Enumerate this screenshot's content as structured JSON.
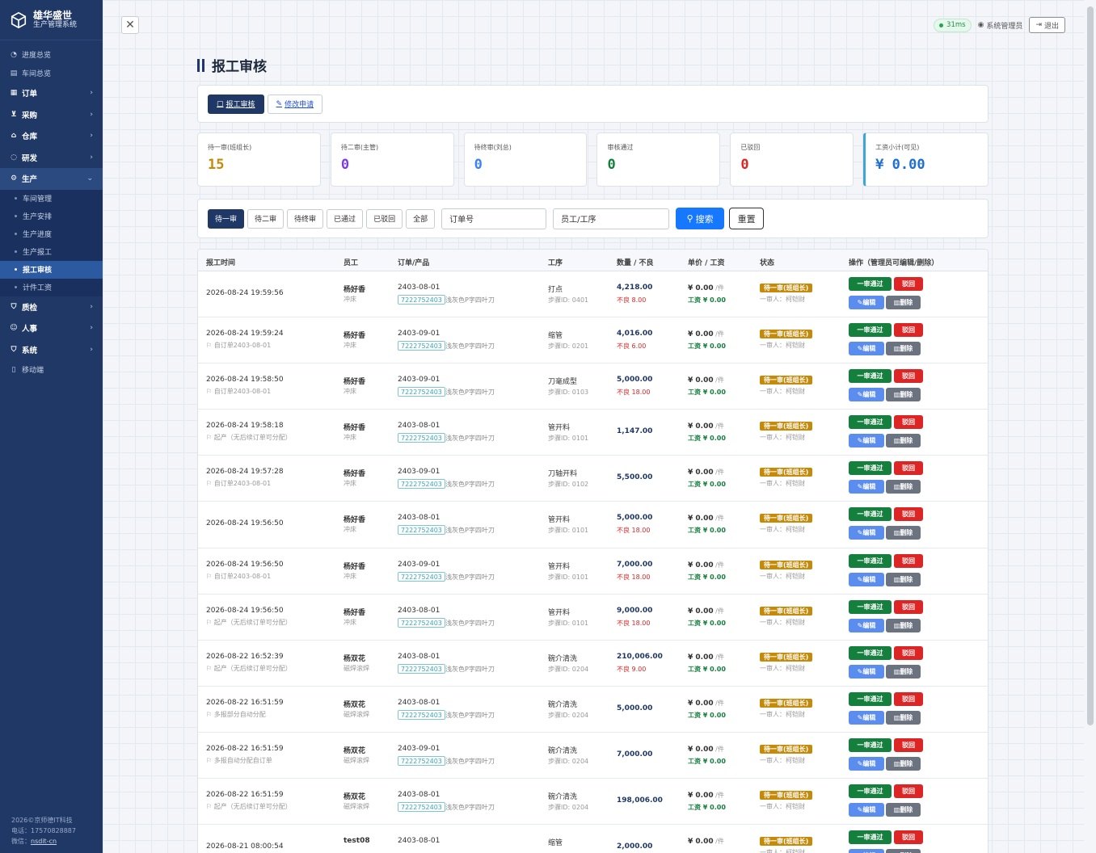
{
  "brand": {
    "title": "雄华盛世",
    "subtitle": "生产管理系统"
  },
  "sidebar": {
    "top": [
      {
        "label": "进度总览"
      },
      {
        "label": "车间总览"
      }
    ],
    "groups": [
      {
        "label": "订单"
      },
      {
        "label": "采购"
      },
      {
        "label": "仓库"
      },
      {
        "label": "研发"
      }
    ],
    "production": {
      "label": "生产",
      "items": [
        {
          "label": "车间管理"
        },
        {
          "label": "生产安排"
        },
        {
          "label": "生产进度"
        },
        {
          "label": "生产报工"
        },
        {
          "label": "报工审核"
        },
        {
          "label": "计件工资"
        }
      ]
    },
    "groups2": [
      {
        "label": "质检"
      },
      {
        "label": "人事"
      },
      {
        "label": "系统"
      }
    ],
    "mobile": "移动端",
    "footer": {
      "copy": "2026©京师德IT科技",
      "phone": "电话：17570828887",
      "wechat_label": "微信：",
      "wechat": "nsdit-cn"
    }
  },
  "topbar": {
    "ping": "31ms",
    "user": "系统管理员",
    "logout": "退出"
  },
  "page": {
    "title": "报工审核"
  },
  "tabs": [
    {
      "label": "报工审核"
    },
    {
      "label": "修改申请"
    }
  ],
  "stats": [
    {
      "label": "待一审(班组长)",
      "value": "15",
      "color": "#c58a09"
    },
    {
      "label": "待二审(主管)",
      "value": "0",
      "color": "#7c3aed"
    },
    {
      "label": "待终审(刘总)",
      "value": "0",
      "color": "#3b82f6"
    },
    {
      "label": "审核通过",
      "value": "0",
      "color": "#15803d"
    },
    {
      "label": "已驳回",
      "value": "0",
      "color": "#dc2626"
    },
    {
      "label": "工资小计(可见)",
      "value": "¥ 0.00",
      "color": "#1d6fd8"
    }
  ],
  "filters": {
    "buttons": [
      "待一审",
      "待二审",
      "待终审",
      "已通过",
      "已驳回",
      "全部"
    ],
    "order_placeholder": "订单号",
    "worker_placeholder": "员工/工序",
    "search": "搜索",
    "reset": "重置"
  },
  "table": {
    "headers": [
      "报工时间",
      "员工",
      "订单/产品",
      "工序",
      "数量 / 不良",
      "单价 / 工资",
      "状态",
      "操作（管理员可编辑/删除）"
    ],
    "labels": {
      "pass": "一审通过",
      "reject": "驳回",
      "edit": "编辑",
      "delete": "删除",
      "unit": "/件",
      "wage_prefix": "工资 ",
      "bad_prefix": "不良 ",
      "step_prefix": "步骤ID: ",
      "reviewer": "一审人：柯铠财"
    },
    "rows": [
      {
        "time": "2026-08-24 19:59:56",
        "src": "",
        "name": "杨好香",
        "dept": "冲床",
        "order": "2403-08-01",
        "code": "7222752403",
        "product": "浅灰色P字四叶刀",
        "process": "打点",
        "step": "0401",
        "qty": "4,218.00",
        "bad": "8.00",
        "price": "¥ 0.00",
        "wage": "¥ 0.00",
        "status": "待一审(班组长)"
      },
      {
        "time": "2026-08-24 19:59:24",
        "src": "自订单2403-08-01",
        "name": "杨好香",
        "dept": "冲床",
        "order": "2403-09-01",
        "code": "7222752403",
        "product": "浅灰色P字四叶刀",
        "process": "缩管",
        "step": "0201",
        "qty": "4,016.00",
        "bad": "6.00",
        "price": "¥ 0.00",
        "wage": "¥ 0.00",
        "status": "待一审(班组长)"
      },
      {
        "time": "2026-08-24 19:58:50",
        "src": "自订单2403-08-01",
        "name": "杨好香",
        "dept": "冲床",
        "order": "2403-09-01",
        "code": "7222752403",
        "product": "浅灰色P字四叶刀",
        "process": "刀毫成型",
        "step": "0103",
        "qty": "5,000.00",
        "bad": "18.00",
        "price": "¥ 0.00",
        "wage": "¥ 0.00",
        "status": "待一审(班组长)"
      },
      {
        "time": "2026-08-24 19:58:18",
        "src": "起产（无后续订单可分配）",
        "name": "杨好香",
        "dept": "冲床",
        "order": "2403-08-01",
        "code": "7222752403",
        "product": "浅灰色P字四叶刀",
        "process": "管开料",
        "step": "0101",
        "qty": "1,147.00",
        "bad": "",
        "price": "¥ 0.00",
        "wage": "¥ 0.00",
        "status": "待一审(班组长)"
      },
      {
        "time": "2026-08-24 19:57:28",
        "src": "自订单2403-08-01",
        "name": "杨好香",
        "dept": "冲床",
        "order": "2403-09-01",
        "code": "7222752403",
        "product": "浅灰色P字四叶刀",
        "process": "刀轴开料",
        "step": "0102",
        "qty": "5,500.00",
        "bad": "",
        "price": "¥ 0.00",
        "wage": "¥ 0.00",
        "status": "待一审(班组长)"
      },
      {
        "time": "2026-08-24 19:56:50",
        "src": "",
        "name": "杨好香",
        "dept": "冲床",
        "order": "2403-08-01",
        "code": "7222752403",
        "product": "浅灰色P字四叶刀",
        "process": "管开料",
        "step": "0101",
        "qty": "5,000.00",
        "bad": "18.00",
        "price": "¥ 0.00",
        "wage": "¥ 0.00",
        "status": "待一审(班组长)"
      },
      {
        "time": "2026-08-24 19:56:50",
        "src": "自订单2403-08-01",
        "name": "杨好香",
        "dept": "冲床",
        "order": "2403-09-01",
        "code": "7222752403",
        "product": "浅灰色P字四叶刀",
        "process": "管开料",
        "step": "0101",
        "qty": "7,000.00",
        "bad": "18.00",
        "price": "¥ 0.00",
        "wage": "¥ 0.00",
        "status": "待一审(班组长)"
      },
      {
        "time": "2026-08-24 19:56:50",
        "src": "起产（无后续订单可分配）",
        "name": "杨好香",
        "dept": "冲床",
        "order": "2403-08-01",
        "code": "7222752403",
        "product": "浅灰色P字四叶刀",
        "process": "管开料",
        "step": "0101",
        "qty": "9,000.00",
        "bad": "18.00",
        "price": "¥ 0.00",
        "wage": "¥ 0.00",
        "status": "待一审(班组长)"
      },
      {
        "time": "2026-08-22 16:52:39",
        "src": "起产（无后续订单可分配）",
        "name": "杨双花",
        "dept": "磁焊滚焊",
        "order": "2403-08-01",
        "code": "7222752403",
        "product": "浅灰色P字四叶刀",
        "process": "碗介清洗",
        "step": "0204",
        "qty": "210,006.00",
        "bad": "9.00",
        "price": "¥ 0.00",
        "wage": "¥ 0.00",
        "status": "待一审(班组长)"
      },
      {
        "time": "2026-08-22 16:51:59",
        "src": "多报部分自动分配",
        "name": "杨双花",
        "dept": "磁焊滚焊",
        "order": "2403-08-01",
        "code": "7222752403",
        "product": "浅灰色P字四叶刀",
        "process": "碗介清洗",
        "step": "0204",
        "qty": "5,000.00",
        "bad": "",
        "price": "¥ 0.00",
        "wage": "¥ 0.00",
        "status": "待一审(班组长)"
      },
      {
        "time": "2026-08-22 16:51:59",
        "src": "多报自动分配自订单",
        "name": "杨双花",
        "dept": "磁焊滚焊",
        "order": "2403-09-01",
        "code": "7222752403",
        "product": "浅灰色P字四叶刀",
        "process": "碗介清洗",
        "step": "0204",
        "qty": "7,000.00",
        "bad": "",
        "price": "¥ 0.00",
        "wage": "¥ 0.00",
        "status": "待一审(班组长)"
      },
      {
        "time": "2026-08-22 16:51:59",
        "src": "起产（无后续订单可分配）",
        "name": "杨双花",
        "dept": "磁焊滚焊",
        "order": "2403-08-01",
        "code": "7222752403",
        "product": "浅灰色P字四叶刀",
        "process": "碗介清洗",
        "step": "0204",
        "qty": "198,006.00",
        "bad": "",
        "price": "¥ 0.00",
        "wage": "¥ 0.00",
        "status": "待一审(班组长)"
      },
      {
        "time": "2026-08-21 08:00:54",
        "src": "",
        "name": "test08",
        "dept": "",
        "order": "2403-08-01",
        "code": "",
        "product": "",
        "process": "缩管",
        "step": "",
        "qty": "2,000.00",
        "bad": "",
        "price": "¥ 0.00",
        "wage": "",
        "status": "待一审(班组长)"
      }
    ]
  }
}
